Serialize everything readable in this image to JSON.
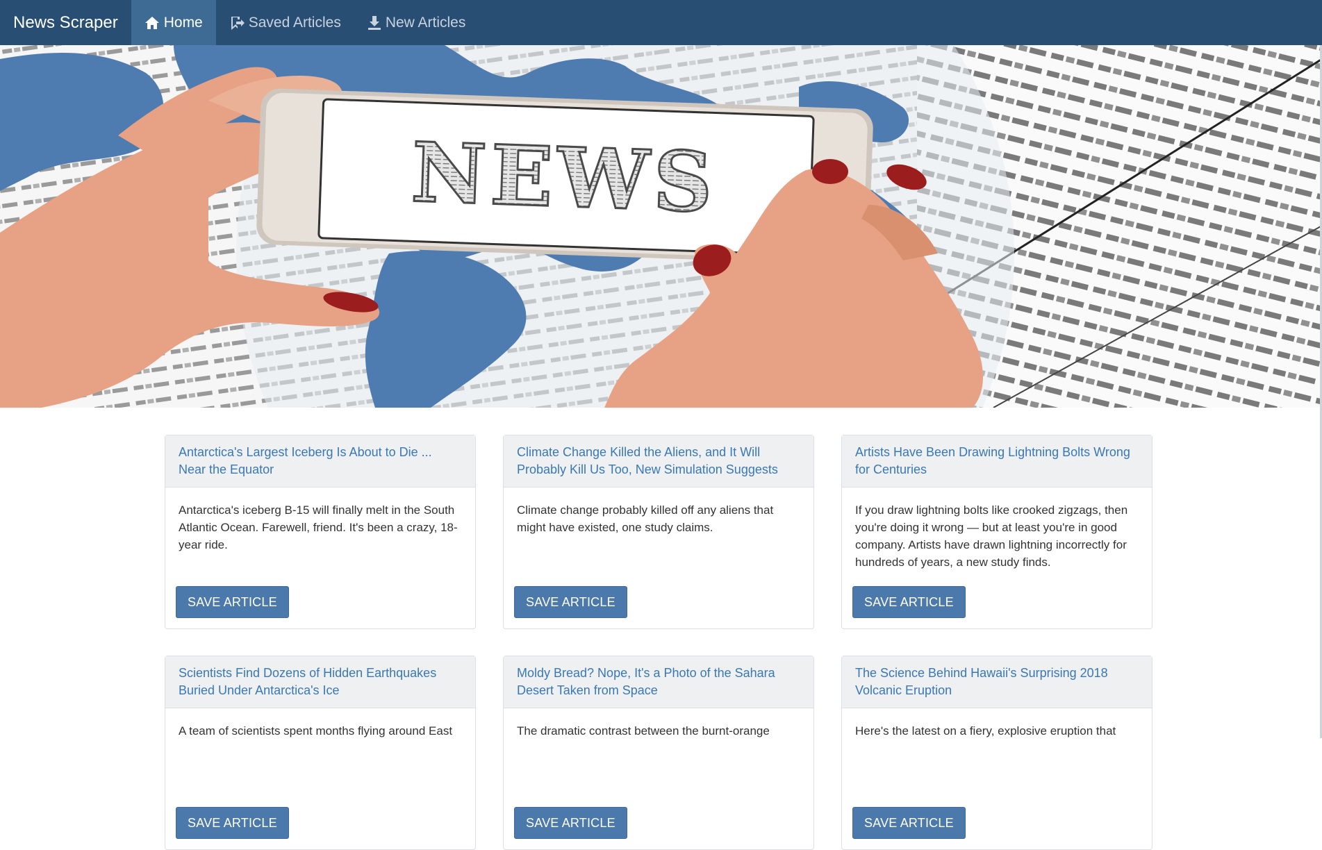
{
  "navbar": {
    "brand": "News Scraper",
    "items": [
      {
        "label": "Home",
        "icon": "home-icon",
        "active": true
      },
      {
        "label": "Saved Articles",
        "icon": "bookmark-icon",
        "active": false
      },
      {
        "label": "New Articles",
        "icon": "download-icon",
        "active": false
      }
    ]
  },
  "hero": {
    "headline_image_text": "NEWS"
  },
  "articles": [
    {
      "title": "Antarctica's Largest Iceberg Is About to Die ... Near the Equator",
      "summary": "Antarctica's iceberg B-15 will finally melt in the South Atlantic Ocean. Farewell, friend. It's been a crazy, 18-year ride.",
      "button": "SAVE ARTICLE"
    },
    {
      "title": "Climate Change Killed the Aliens, and It Will Probably Kill Us Too, New Simulation Suggests",
      "summary": "Climate change probably killed off any aliens that might have existed, one study claims.",
      "button": "SAVE ARTICLE"
    },
    {
      "title": "Artists Have Been Drawing Lightning Bolts Wrong for Centuries",
      "summary": "If you draw lightning bolts like crooked zigzags, then you're doing it wrong — but at least you're in good company. Artists have drawn lightning incorrectly for hundreds of years, a new study finds.",
      "button": "SAVE ARTICLE"
    },
    {
      "title": "Scientists Find Dozens of Hidden Earthquakes Buried Under Antarctica's Ice",
      "summary": "A team of scientists spent months flying around East",
      "button": "SAVE ARTICLE"
    },
    {
      "title": "Moldy Bread? Nope, It's a Photo of the Sahara Desert Taken from Space",
      "summary": "The dramatic contrast between the burnt-orange",
      "button": "SAVE ARTICLE"
    },
    {
      "title": "The Science Behind Hawaii's Surprising 2018 Volcanic Eruption",
      "summary": "Here's the latest on a fiery, explosive eruption that",
      "button": "SAVE ARTICLE"
    }
  ],
  "colors": {
    "navbar": "#284e74",
    "navbar_active": "#3d6b94",
    "link": "#3a78b4",
    "button": "#4b79ab"
  }
}
